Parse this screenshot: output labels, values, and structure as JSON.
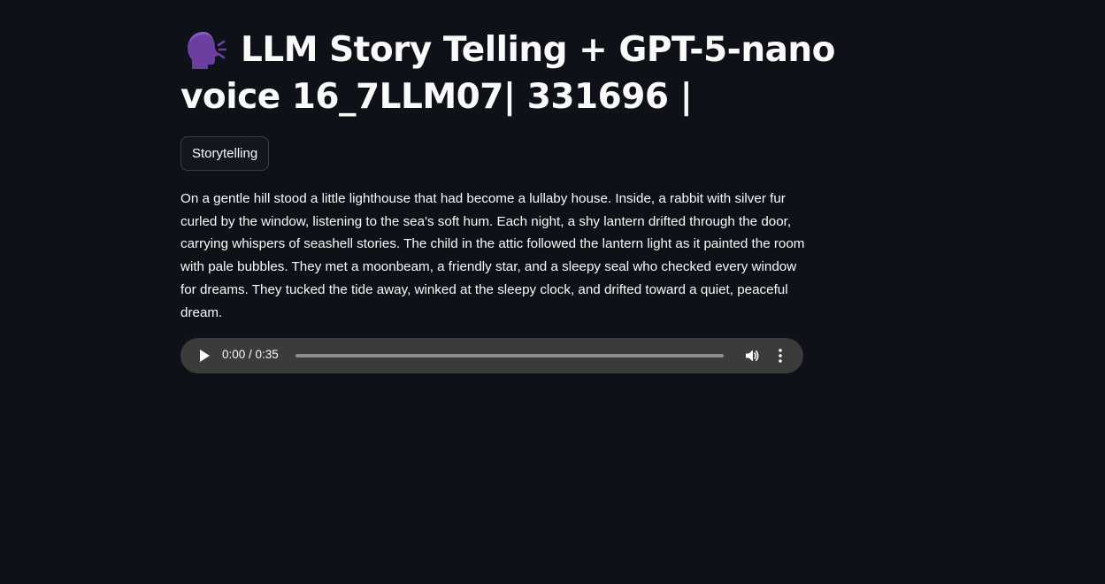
{
  "header": {
    "icon": "speaking-head-icon",
    "title_line1": "LLM Story Telling + GPT-5-nano",
    "title_line2": "voice 16_7LLM07| 331696 |"
  },
  "tag": {
    "label": "Storytelling"
  },
  "story": {
    "text": "On a gentle hill stood a little lighthouse that had become a lullaby house. Inside, a rabbit with silver fur curled by the window, listening to the sea's soft hum. Each night, a shy lantern drifted through the door, carrying whispers of seashell stories. The child in the attic followed the lantern light as it painted the room with pale bubbles. They met a moonbeam, a friendly star, and a sleepy seal who checked every window for dreams. They tucked the tide away, winked at the sleepy clock, and drifted toward a quiet, peaceful dream."
  },
  "audio_player": {
    "time_display": "0:00 / 0:35",
    "current_time": "0:00",
    "duration": "0:35",
    "progress_fraction": 0,
    "play_icon": "play-icon",
    "volume_icon": "volume-icon",
    "more_icon": "more-vertical-icon"
  },
  "colors": {
    "background": "#0e1117",
    "text": "#fafafa",
    "player_background": "#3b3b3b",
    "icon_purple": "#6b3fa0"
  }
}
